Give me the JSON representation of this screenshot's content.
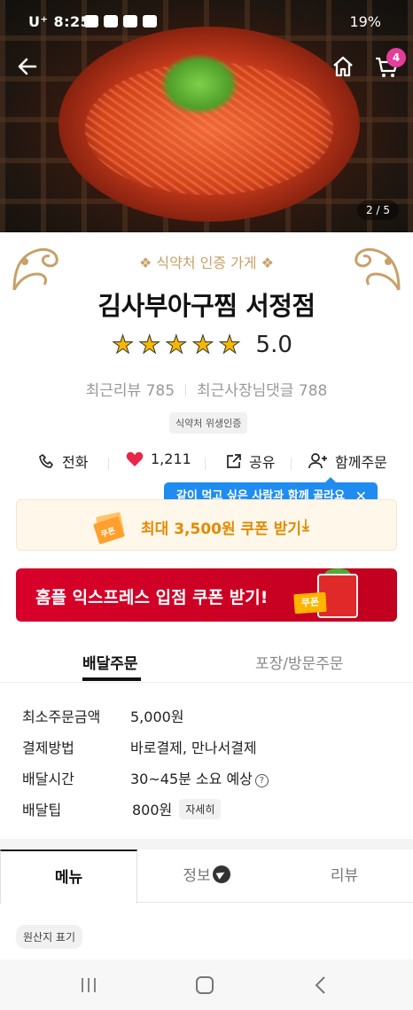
{
  "status_bar": {
    "carrier_time": "U⁺ 8:25",
    "battery": "19%"
  },
  "header": {
    "back_icon": "back-arrow-icon",
    "home_icon": "home-icon",
    "cart_icon": "cart-icon",
    "cart_count": "4",
    "image_pager": "2 / 5"
  },
  "store": {
    "certification": "❖ 식약처 인증 가게 ❖",
    "name": "김사부아구찜 서정점",
    "rating": "5.0",
    "star_count": 5,
    "recent_reviews": "최근리뷰 785",
    "owner_replies": "최근사장님댓글 788",
    "hygiene_badge": "식약처 위생인증"
  },
  "actions": {
    "call": "전화",
    "likes": "1,211",
    "share": "공유",
    "group_order": "함께주문",
    "tooltip": "같이 먹고 싶은 사람과 함께 골라요",
    "tooltip_close": "✕"
  },
  "coupon": {
    "label": "최대 3,500원 쿠폰 받기",
    "arrow": "⤓",
    "ticket_text": "쿠폰"
  },
  "banner": {
    "label": "홈플 익스프레스 입점 쿠폰 받기!",
    "tag": "쿠폰"
  },
  "order_tabs": {
    "delivery": "배달주문",
    "pickup": "포장/방문주문"
  },
  "delivery_info": {
    "min_order_label": "최소주문금액",
    "min_order_value": "5,000원",
    "payment_label": "결제방법",
    "payment_value": "바로결제, 만나서결제",
    "time_label": "배달시간",
    "time_value": "30~45분 소요 예상",
    "tip_label": "배달팁",
    "tip_value": "800원",
    "tip_detail": "자세히",
    "help_glyph": "?"
  },
  "main_tabs": {
    "menu": "메뉴",
    "info": "정보",
    "review": "리뷰"
  },
  "origin_label": "원산지 표기",
  "colors": {
    "accent_gold": "#c8a068",
    "coupon_orange": "#e28a00",
    "banner_red": "#d8002a",
    "tooltip_blue": "#1e8cf0",
    "badge_pink": "#e43d9a",
    "star_yellow": "#f5b800",
    "heart_red": "#e8264a"
  }
}
